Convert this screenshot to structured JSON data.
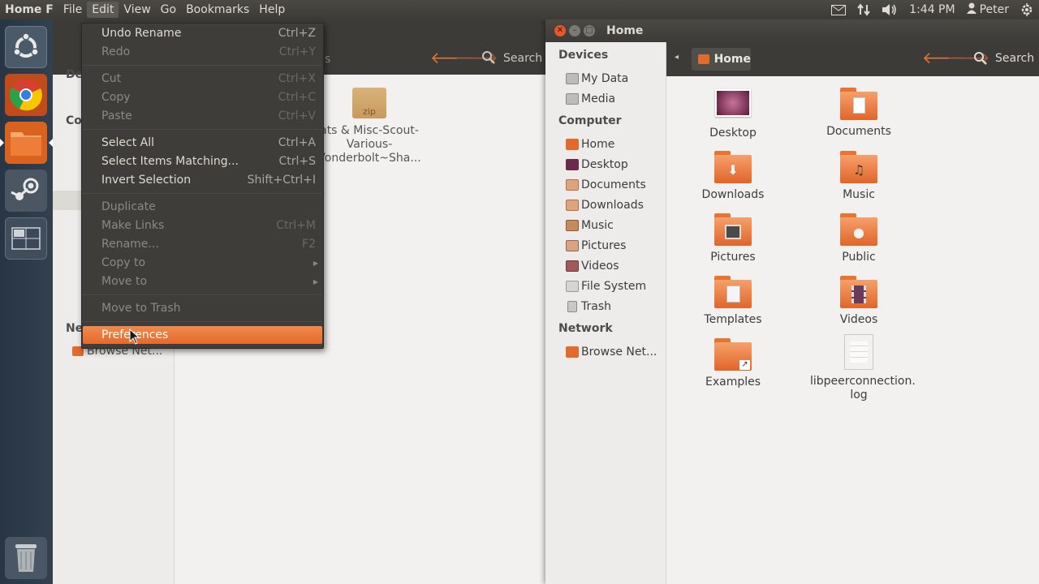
{
  "top_panel": {
    "app_title": "Home F",
    "menus": [
      "File",
      "Edit",
      "View",
      "Go",
      "Bookmarks",
      "Help"
    ],
    "time": "1:44 PM",
    "user": "Peter"
  },
  "launcher": {
    "items": [
      "ubuntu-dash-icon",
      "chrome-icon",
      "files-icon",
      "steam-icon",
      "workspace-switcher-icon",
      "trash-icon"
    ]
  },
  "edit_menu": {
    "groups": [
      [
        {
          "label": "Undo Rename",
          "shortcut": "Ctrl+Z",
          "enabled": true
        },
        {
          "label": "Redo",
          "shortcut": "Ctrl+Y",
          "enabled": false
        }
      ],
      [
        {
          "label": "Cut",
          "shortcut": "Ctrl+X",
          "enabled": false
        },
        {
          "label": "Copy",
          "shortcut": "Ctrl+C",
          "enabled": false
        },
        {
          "label": "Paste",
          "shortcut": "Ctrl+V",
          "enabled": false
        }
      ],
      [
        {
          "label": "Select All",
          "shortcut": "Ctrl+A",
          "enabled": true
        },
        {
          "label": "Select Items Matching...",
          "shortcut": "Ctrl+S",
          "enabled": true
        },
        {
          "label": "Invert Selection",
          "shortcut": "Shift+Ctrl+I",
          "enabled": true
        }
      ],
      [
        {
          "label": "Duplicate",
          "shortcut": "",
          "enabled": false
        },
        {
          "label": "Make Links",
          "shortcut": "Ctrl+M",
          "enabled": false
        },
        {
          "label": "Rename...",
          "shortcut": "F2",
          "enabled": false
        },
        {
          "label": "Copy to",
          "shortcut": "",
          "enabled": false,
          "submenu": true
        },
        {
          "label": "Move to",
          "shortcut": "",
          "enabled": false,
          "submenu": true
        }
      ],
      [
        {
          "label": "Move to Trash",
          "shortcut": "",
          "enabled": false
        }
      ],
      [
        {
          "label": "Preferences",
          "shortcut": "",
          "enabled": true,
          "highlighted": true
        }
      ]
    ]
  },
  "left_window": {
    "file_label": "ats & Misc-Scout-\nVarious-\nVonderbolt~Sha...",
    "file_type": "zip",
    "sidebar_headings": [
      "De",
      "Co",
      "Ne"
    ],
    "sidebar_network_item": "Browse Net...",
    "toolbar_search": "Search",
    "toolbar_fragment": "s"
  },
  "home_window": {
    "title": "Home",
    "path_button": "Home",
    "search_label": "Search",
    "sidebar": {
      "devices_heading": "Devices",
      "devices": [
        "My Data",
        "Media"
      ],
      "computer_heading": "Computer",
      "computer": [
        "Home",
        "Desktop",
        "Documents",
        "Downloads",
        "Music",
        "Pictures",
        "Videos",
        "File System",
        "Trash"
      ],
      "network_heading": "Network",
      "network": [
        "Browse Net..."
      ]
    },
    "files": [
      "Desktop",
      "Documents",
      "Downloads",
      "Music",
      "Pictures",
      "Public",
      "Templates",
      "Videos",
      "Examples",
      "libpeerconnection.\nlog"
    ]
  },
  "colors": {
    "accent": "#e4692c",
    "panel": "#3c3b37",
    "folder": "#f0884a"
  }
}
